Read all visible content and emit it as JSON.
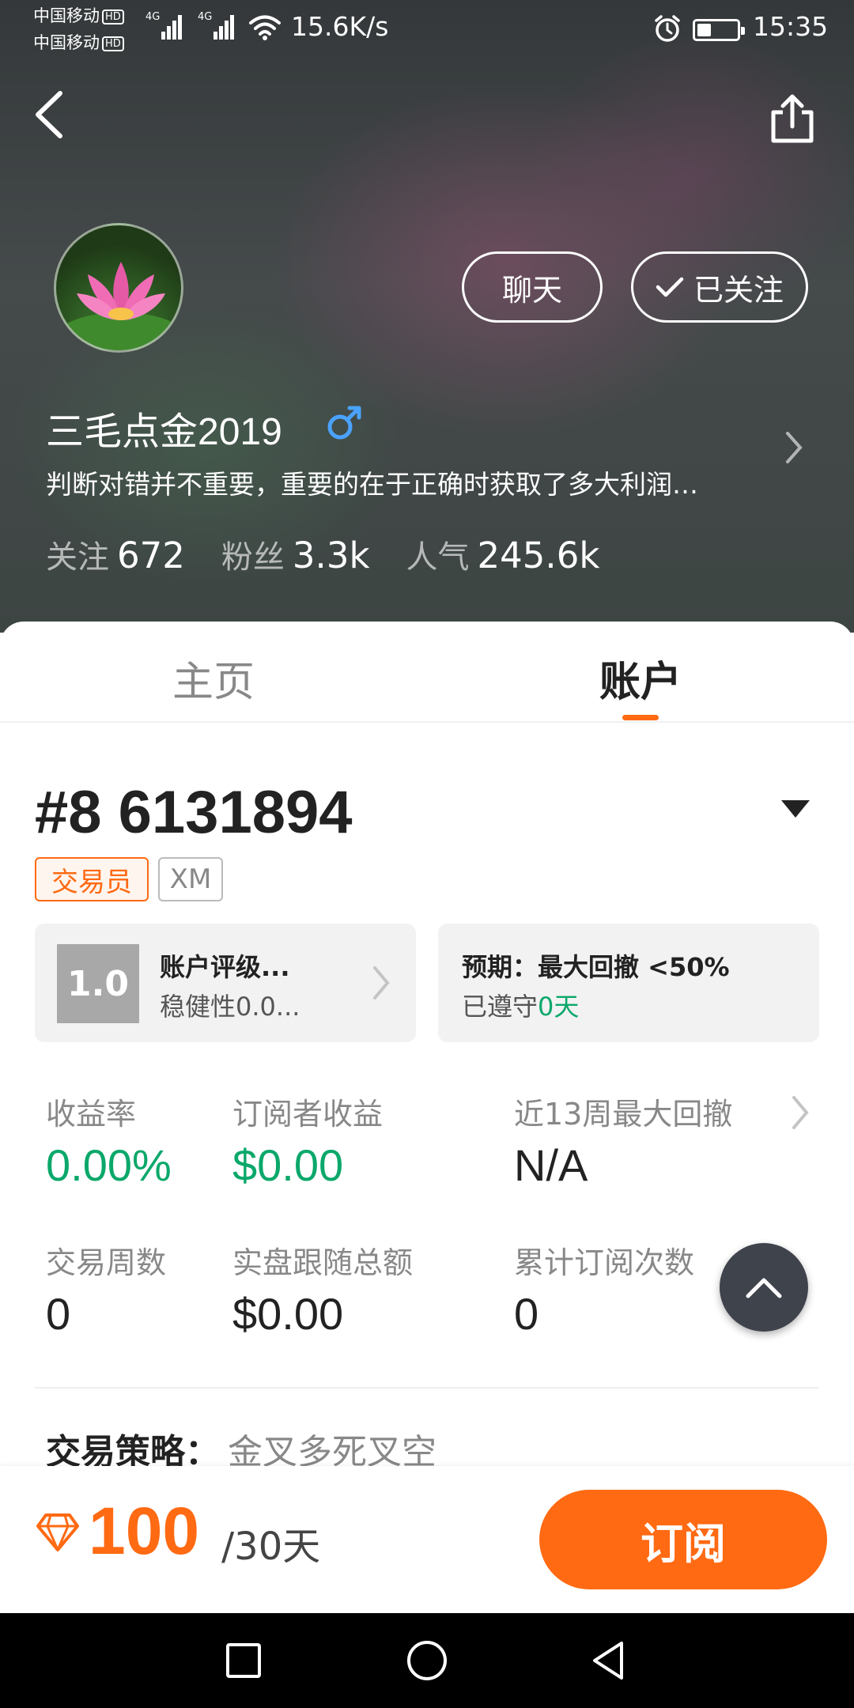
{
  "status_bar": {
    "carrier1": "中国移动",
    "carrier2": "中国移动",
    "hd_badge": "HD",
    "network1": "4G",
    "network2": "4G",
    "net_speed": "15.6K/s",
    "battery_level": 0.35,
    "time": "15:35",
    "icons": [
      "signal-icon",
      "wifi-icon",
      "alarm-icon",
      "battery-icon"
    ]
  },
  "header": {
    "back_icon": "back-arrow-icon",
    "share_icon": "share-icon"
  },
  "profile": {
    "chat_label": "聊天",
    "follow_label": "已关注",
    "follow_icon": "check-icon",
    "username": "三毛点金2019",
    "gender_icon": "male-icon",
    "bio": "判断对错并不重要，重要的在于正确时获取了多大利润…",
    "stats": [
      {
        "label": "关注",
        "value": "672"
      },
      {
        "label": "粉丝",
        "value": "3.3k"
      },
      {
        "label": "人气",
        "value": "245.6k"
      }
    ]
  },
  "tabs": [
    {
      "label": "主页",
      "active": false
    },
    {
      "label": "账户",
      "active": true
    }
  ],
  "account": {
    "number": "#8 6131894",
    "tag_trader": "交易员",
    "tag_broker": "XM",
    "rating_score": "1.0",
    "rating_title": "账户评级...",
    "rating_sub": "稳健性0.0...",
    "expect_title": "预期：最大回撤 <50%",
    "expect_sub_prefix": "已遵守",
    "expect_days": "0天"
  },
  "metrics": [
    {
      "label": "收益率",
      "value": "0.00%",
      "highlight": true
    },
    {
      "label": "订阅者收益",
      "value": "$0.00",
      "highlight": true
    },
    {
      "label": "近13周最大回撤",
      "value": "N/A",
      "highlight": false
    },
    {
      "label": "交易周数",
      "value": "0",
      "highlight": false
    },
    {
      "label": "实盘跟随总额",
      "value": "$0.00",
      "highlight": false
    },
    {
      "label": "累计订阅次数",
      "value": "0",
      "highlight": false
    }
  ],
  "strategy": {
    "label": "交易策略：",
    "value": "金叉多死叉空"
  },
  "subscribe": {
    "price": "100",
    "period": "/30天",
    "button": "订阅",
    "price_icon": "diamond-icon"
  },
  "colors": {
    "accent": "#ff6a13",
    "positive": "#0aa86a",
    "fab": "#3e434c"
  }
}
